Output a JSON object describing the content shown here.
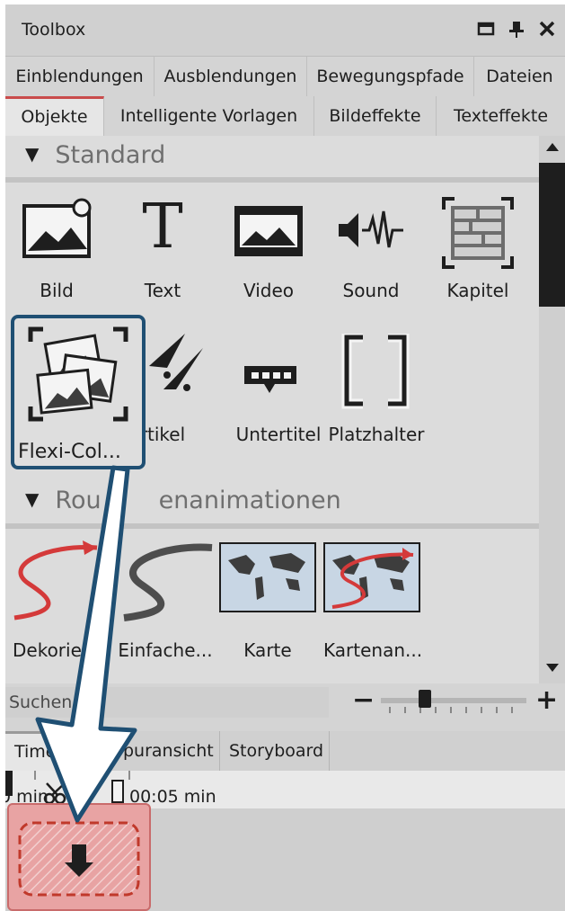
{
  "window": {
    "title": "Toolbox"
  },
  "tabs_row1": [
    {
      "label": "Einblendungen"
    },
    {
      "label": "Ausblendungen"
    },
    {
      "label": "Bewegungspfade"
    },
    {
      "label": "Dateien"
    }
  ],
  "tabs_row2": [
    {
      "label": "Objekte",
      "active": true
    },
    {
      "label": "Intelligente Vorlagen"
    },
    {
      "label": "Bildeffekte"
    },
    {
      "label": "Texteffekte"
    }
  ],
  "sections": {
    "standard": {
      "title": "Standard",
      "items": [
        {
          "label": "Bild",
          "icon": "image-icon"
        },
        {
          "label": "Text",
          "icon": "text-icon"
        },
        {
          "label": "Video",
          "icon": "video-icon"
        },
        {
          "label": "Sound",
          "icon": "sound-icon"
        },
        {
          "label": "Kapitel",
          "icon": "chapter-icon"
        },
        {
          "label": "Flexi-Col...",
          "icon": "flexi-collage-icon"
        },
        {
          "label": "rtikel",
          "icon": "particles-icon"
        },
        {
          "label": "Untertitel",
          "icon": "subtitle-icon"
        },
        {
          "label": "Platzhalter",
          "icon": "placeholder-icon"
        }
      ]
    },
    "route": {
      "title": "Rou",
      "title_tail": "enanimationen",
      "items": [
        {
          "label": "Dekorie",
          "icon": "decorative-route-icon"
        },
        {
          "label": "Einfache...",
          "icon": "simple-route-icon"
        },
        {
          "label": "Karte",
          "icon": "map-icon"
        },
        {
          "label": "Kartenan...",
          "icon": "map-animation-icon"
        }
      ]
    }
  },
  "search": {
    "placeholder": "Suchen"
  },
  "zoom": {
    "minus": "−",
    "plus": "+",
    "level": 0.3
  },
  "bottom_tabs": [
    {
      "label": "Time",
      "active": true
    },
    {
      "label": "puransicht"
    },
    {
      "label": "Storyboard"
    }
  ],
  "timeline": {
    "start_label": "0 min",
    "mark_label": "00:05 min"
  },
  "colors": {
    "accent": "#c94b4b",
    "drag_border": "#1f4f73",
    "drop_fill": "#e8a3a3"
  }
}
